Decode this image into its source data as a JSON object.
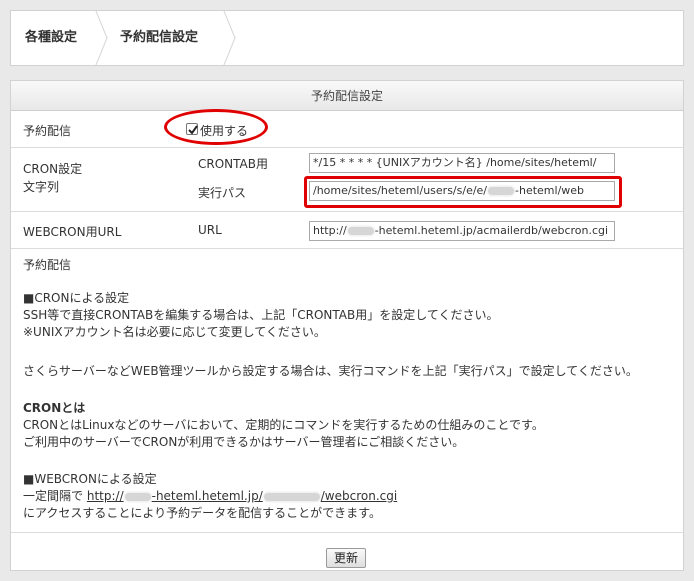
{
  "breadcrumb": {
    "items": [
      "各種設定",
      "予約配信設定"
    ]
  },
  "panel": {
    "title": "予約配信設定",
    "rows": {
      "delivery": {
        "label": "予約配信",
        "checkbox_checked": true,
        "checkbox_label": "使用する"
      },
      "cron": {
        "label_line1": "CRON設定",
        "label_line2": "文字列",
        "crontab_label": "CRONTAB用",
        "crontab_value": "*/15 * * * *  {UNIXアカウント名} /home/sites/heteml/",
        "exec_label": "実行パス",
        "exec_value_part1": "/home/sites/heteml/users/s/e/e/",
        "exec_value_part2": "-heteml/web"
      },
      "webcron": {
        "label": "WEBCRON用URL",
        "url_label": "URL",
        "url_value_part1": "http://",
        "url_value_part2": "-heteml.heteml.jp/acmailerdb/webcron.cgi"
      }
    },
    "description": {
      "heading": "予約配信",
      "cron_section_title": "■CRONによる設定",
      "cron_line1": "SSH等で直接CRONTABを編集する場合は、上記「CRONTAB用」を設定してください。",
      "cron_line2": "※UNIXアカウント名は必要に応じて変更してください。",
      "sakura_line": "さくらサーバーなどWEB管理ツールから設定する場合は、実行コマンドを上記「実行パス」で設定してください。",
      "cron_what_title": "CRONとは",
      "cron_what_line1": "CRONとはLinuxなどのサーバにおいて、定期的にコマンドを実行するための仕組みのことです。",
      "cron_what_line2": "ご利用中のサーバーでCRONが利用できるかはサーバー管理者にご相談ください。",
      "webcron_section_title": "■WEBCRONによる設定",
      "webcron_interval_prefix": "一定間隔で",
      "webcron_link_part1": "http://",
      "webcron_link_part2": "-heteml.heteml.jp/",
      "webcron_link_part3": "/webcron.cgi",
      "webcron_line2": "にアクセスすることにより予約データを配信することができます。"
    },
    "update_button": "更新"
  },
  "colors": {
    "highlight": "#e00000",
    "background": "#e9e9e9"
  }
}
